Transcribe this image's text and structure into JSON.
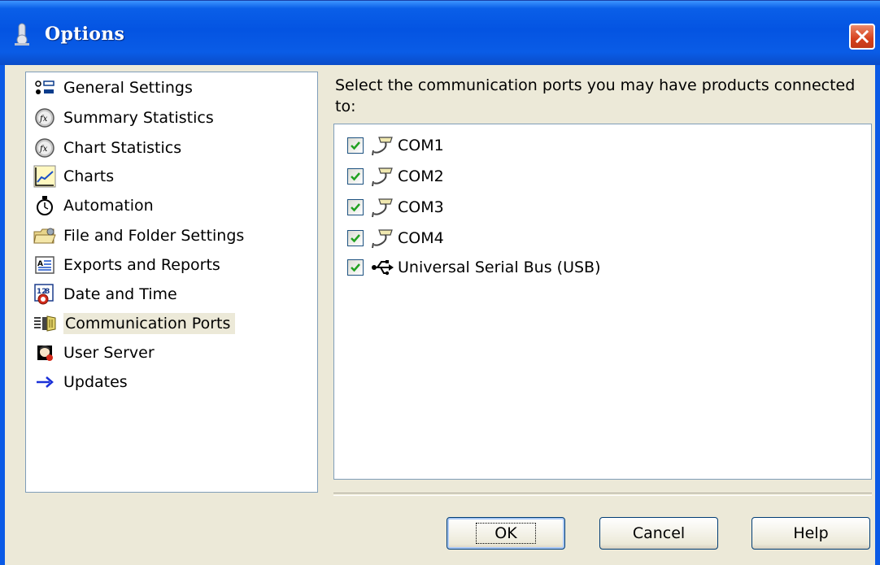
{
  "window": {
    "title": "Options",
    "close_icon": "close-icon"
  },
  "sidebar": {
    "items": [
      {
        "label": "General Settings",
        "icon": "general-settings-icon"
      },
      {
        "label": "Summary Statistics",
        "icon": "function-icon"
      },
      {
        "label": "Chart Statistics",
        "icon": "function-icon"
      },
      {
        "label": "Charts",
        "icon": "chart-icon"
      },
      {
        "label": "Automation",
        "icon": "stopwatch-icon"
      },
      {
        "label": "File and Folder Settings",
        "icon": "folder-icon"
      },
      {
        "label": "Exports and Reports",
        "icon": "report-icon"
      },
      {
        "label": "Date and Time",
        "icon": "calendar-clock-icon"
      },
      {
        "label": "Communication Ports",
        "icon": "serial-port-icon",
        "selected": true
      },
      {
        "label": "User Server",
        "icon": "user-server-icon"
      },
      {
        "label": "Updates",
        "icon": "arrow-right-icon"
      }
    ]
  },
  "main": {
    "instructions": "Select the communication ports you may have products connected to:",
    "ports": [
      {
        "label": "COM1",
        "checked": true,
        "icon": "serial-cable-icon"
      },
      {
        "label": "COM2",
        "checked": true,
        "icon": "serial-cable-icon"
      },
      {
        "label": "COM3",
        "checked": true,
        "icon": "serial-cable-icon"
      },
      {
        "label": "COM4",
        "checked": true,
        "icon": "serial-cable-icon"
      },
      {
        "label": "Universal Serial Bus (USB)",
        "checked": true,
        "icon": "usb-icon"
      }
    ]
  },
  "buttons": {
    "ok": "OK",
    "cancel": "Cancel",
    "help": "Help"
  },
  "colors": {
    "title_bar": "#0454e2",
    "dialog_bg": "#ece9d8",
    "check": "#21a121",
    "close": "#d6411c"
  }
}
